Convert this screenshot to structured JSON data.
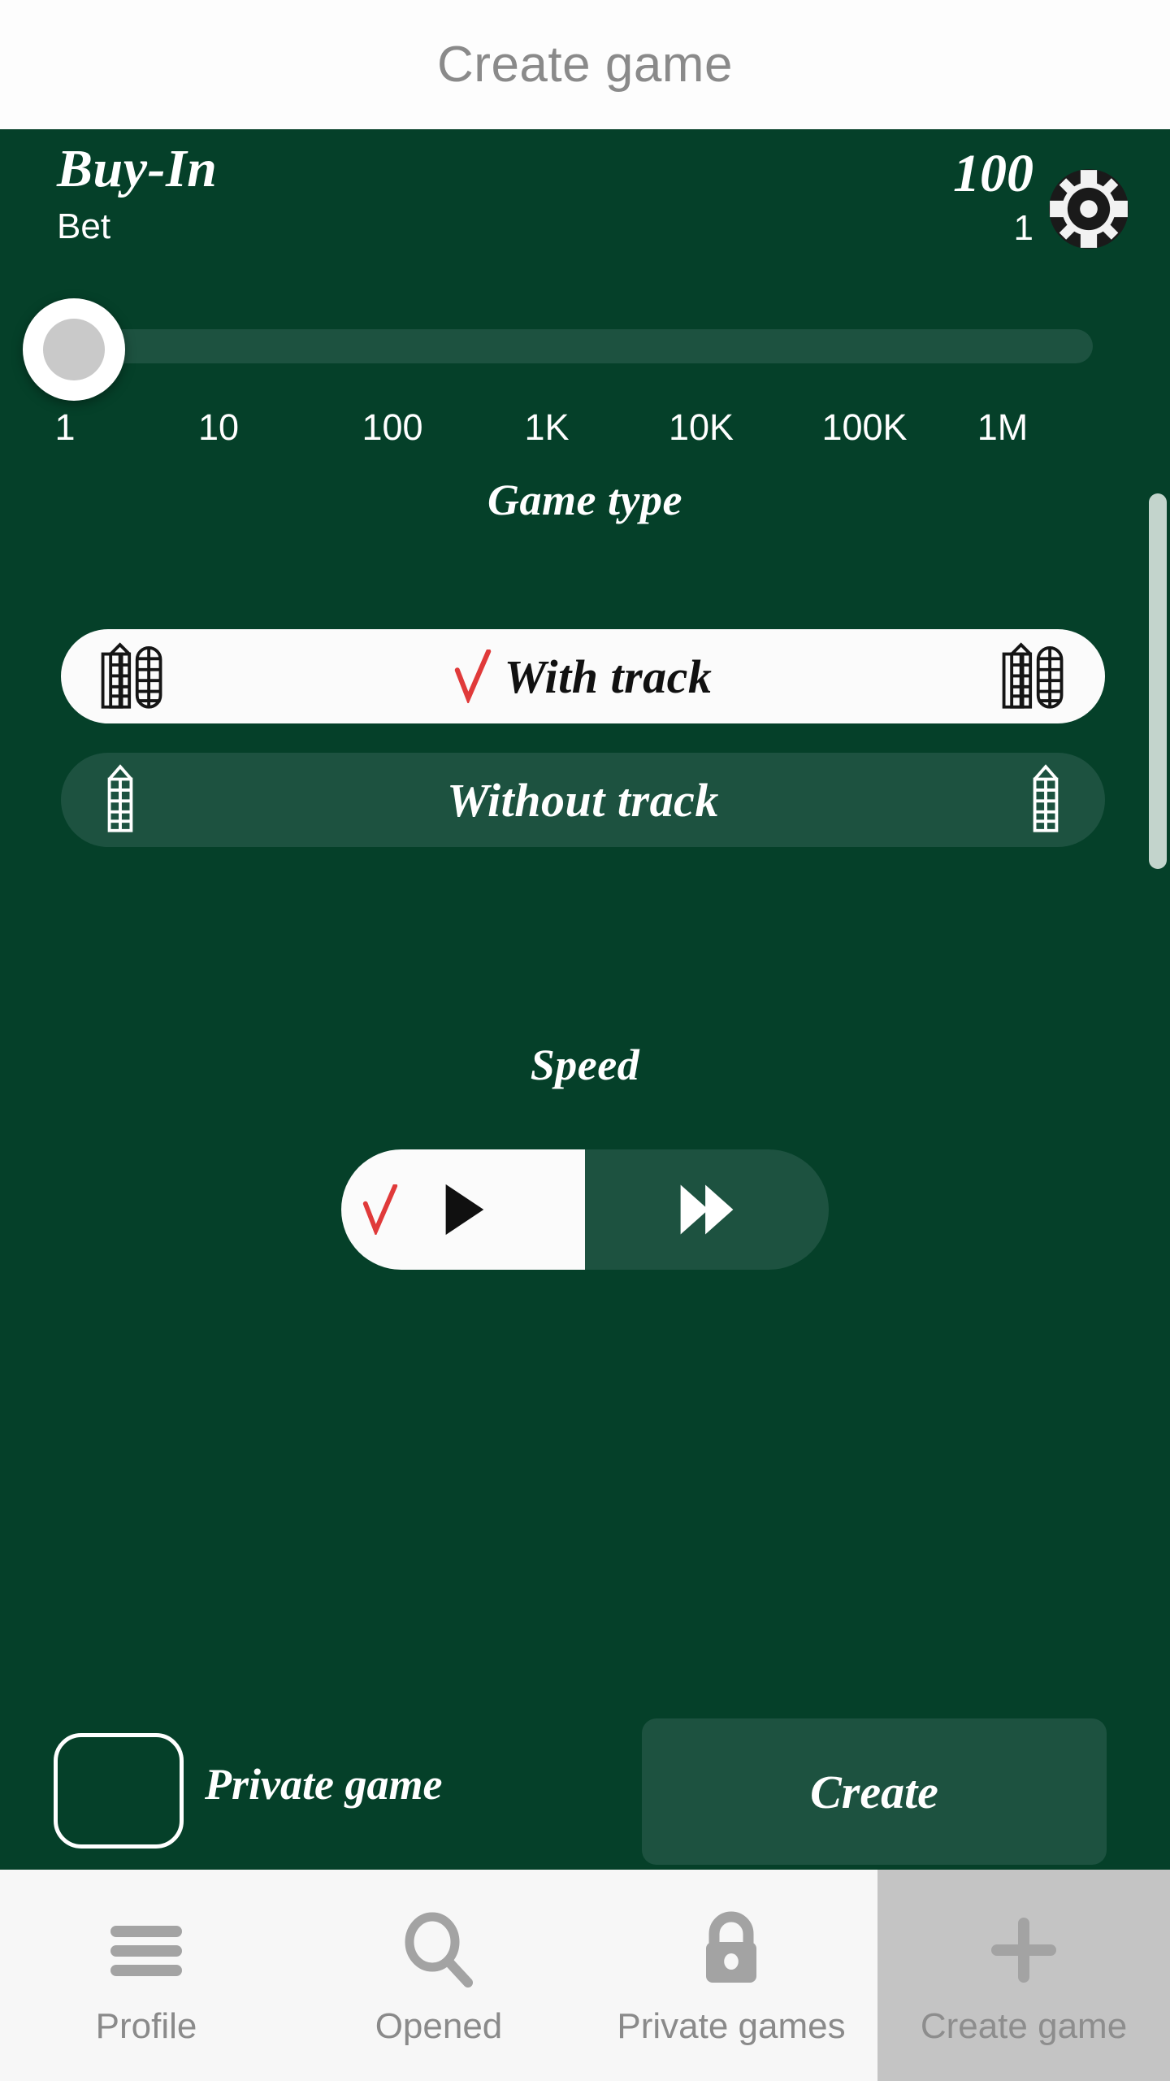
{
  "header": {
    "title": "Create game"
  },
  "buyin": {
    "title": "Buy-In",
    "subtitle": "Bet",
    "amount": "100",
    "chip_count": "1",
    "chip_icon": "poker-chip-icon"
  },
  "slider": {
    "ticks": [
      "1",
      "10",
      "100",
      "1K",
      "10K",
      "100K",
      "1M"
    ],
    "value": "1",
    "min": "1",
    "max": "1M",
    "thumb_position_percent": 0
  },
  "game_type": {
    "heading": "Game type",
    "options": [
      {
        "label": "With track",
        "selected": true,
        "icon": "double-board-icon",
        "check": "check-icon"
      },
      {
        "label": "Without track",
        "selected": false,
        "icon": "single-board-icon",
        "check": ""
      }
    ]
  },
  "speed": {
    "heading": "Speed",
    "options": [
      {
        "icon": "play-icon",
        "selected": true,
        "check": "check-icon"
      },
      {
        "icon": "fast-forward-icon",
        "selected": false,
        "check": ""
      }
    ]
  },
  "footer": {
    "private_label": "Private game",
    "private_checked": false,
    "create_label": "Create"
  },
  "bottom_nav": {
    "items": [
      {
        "label": "Profile",
        "icon": "hamburger-menu-icon",
        "active": false
      },
      {
        "label": "Opened",
        "icon": "search-icon",
        "active": false
      },
      {
        "label": "Private games",
        "icon": "lock-icon",
        "active": false
      },
      {
        "label": "Create game",
        "icon": "plus-icon",
        "active": true
      }
    ]
  },
  "colors": {
    "background_green": "#054029",
    "panel_green": "#1d5240",
    "accent_red": "#e03a3a",
    "white": "#fbfbfb",
    "nav_grey": "#8a8a8a",
    "nav_active_bg": "#c4c4c4",
    "scrollbar": "#c3d4cc"
  }
}
